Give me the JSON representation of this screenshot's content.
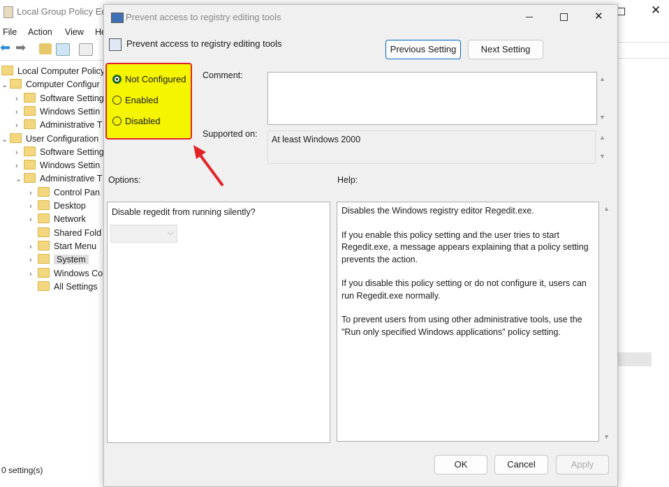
{
  "parent": {
    "title": "Local Group Policy Edi",
    "menu": [
      "File",
      "Action",
      "View",
      "He"
    ],
    "tree": [
      {
        "label": "Local Computer Policy",
        "level": 0,
        "chev": ""
      },
      {
        "label": "Computer Configur",
        "level": 0,
        "chev": "v"
      },
      {
        "label": "Software Setting",
        "level": 1,
        "chev": ">"
      },
      {
        "label": "Windows Settin",
        "level": 1,
        "chev": ">"
      },
      {
        "label": "Administrative T",
        "level": 1,
        "chev": ">"
      },
      {
        "label": "User Configuration",
        "level": 0,
        "chev": "v"
      },
      {
        "label": "Software Setting",
        "level": 1,
        "chev": ">"
      },
      {
        "label": "Windows Settin",
        "level": 1,
        "chev": ">"
      },
      {
        "label": "Administrative T",
        "level": 1,
        "chev": "v"
      },
      {
        "label": "Control Pan",
        "level": 2,
        "chev": ">"
      },
      {
        "label": "Desktop",
        "level": 2,
        "chev": ">"
      },
      {
        "label": "Network",
        "level": 2,
        "chev": ">"
      },
      {
        "label": "Shared Fold",
        "level": 2,
        "chev": ""
      },
      {
        "label": "Start Menu",
        "level": 2,
        "chev": ">"
      },
      {
        "label": "System",
        "level": 2,
        "chev": ">",
        "selected": true
      },
      {
        "label": "Windows Co",
        "level": 2,
        "chev": ">"
      },
      {
        "label": "All Settings",
        "level": 2,
        "chev": ""
      }
    ],
    "status": "0 setting(s)"
  },
  "dialog": {
    "title": "Prevent access to registry editing tools",
    "header": "Prevent access to registry editing tools",
    "prev": "Previous Setting",
    "next": "Next Setting",
    "radios": [
      "Not Configured",
      "Enabled",
      "Disabled"
    ],
    "selected": "Not Configured",
    "comment_label": "Comment:",
    "comment": "",
    "supported_label": "Supported on:",
    "supported": "At least Windows 2000",
    "options_label": "Options:",
    "help_label": "Help:",
    "option_text": "Disable regedit from running silently?",
    "help": [
      "Disables the Windows registry editor Regedit.exe.",
      "If you enable this policy setting and the user tries to start Regedit.exe, a message appears explaining that a policy setting prevents the action.",
      "If you disable this policy setting or do not configure it, users can run Regedit.exe normally.",
      "To prevent users from using other administrative tools, use the \"Run only specified Windows applications\" policy setting."
    ],
    "ok": "OK",
    "cancel": "Cancel",
    "apply": "Apply"
  },
  "colors": {
    "highlight": "#f5f500",
    "annotation": "#e0242a"
  }
}
